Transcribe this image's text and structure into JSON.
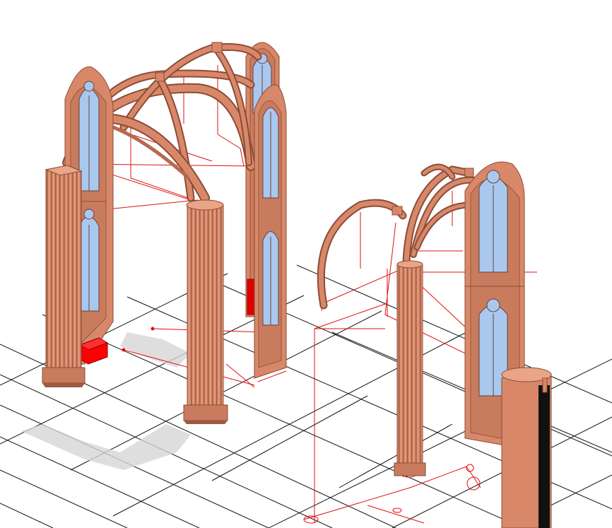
{
  "colors": {
    "background": "#ffffff",
    "grid": "#111111",
    "stone": "#d88868",
    "stone_dark": "#9c5a45",
    "stone_light": "#eaa486",
    "glass": "#a9c8f0",
    "guide_line": "#e01010",
    "selection_box": "#ff0000",
    "shadow": "#cccccc"
  },
  "scene": {
    "description_icon": "3d-model-viewport",
    "objects": [
      {
        "id": "pillar-left-front"
      },
      {
        "id": "pillar-center-front"
      },
      {
        "id": "pillar-right-back"
      },
      {
        "id": "column-dark-right"
      },
      {
        "id": "wall-panel-left-window"
      },
      {
        "id": "wall-panel-back-window"
      },
      {
        "id": "wall-panel-middle-window"
      },
      {
        "id": "wall-panel-right-window"
      },
      {
        "id": "vault-ribs-left-bay"
      },
      {
        "id": "vault-ribs-right-bay"
      },
      {
        "id": "selected-block-left"
      },
      {
        "id": "selected-block-center"
      }
    ]
  }
}
